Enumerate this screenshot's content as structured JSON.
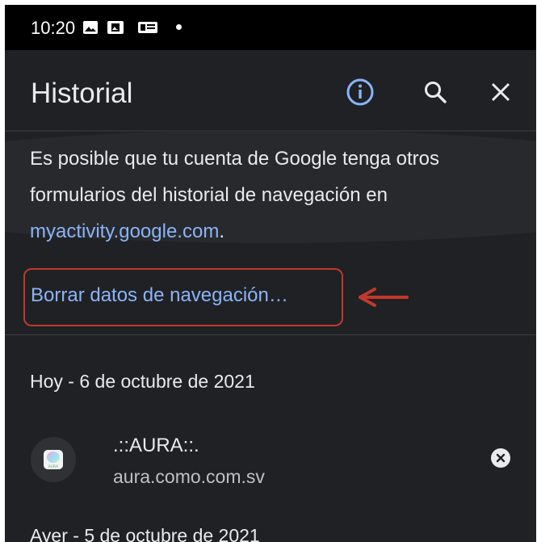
{
  "status_bar": {
    "time": "10:20"
  },
  "app_bar": {
    "title": "Historial",
    "icons": [
      "info-icon",
      "search-icon",
      "close-icon"
    ]
  },
  "info": {
    "text_before": "Es posible que tu cuenta de Google tenga otros formularios del historial de navegación en ",
    "link": "myactivity.google.com",
    "text_after": "."
  },
  "clear_data": {
    "label": "Borrar datos de navegación…"
  },
  "history": {
    "groups": [
      {
        "date": "Hoy - 6 de octubre de 2021",
        "items": [
          {
            "title": ".::AURA::.",
            "url": "aura.como.com.sv",
            "favicon_text": "AURA"
          }
        ]
      },
      {
        "date": "Ayer - 5 de octubre de 2021"
      }
    ]
  },
  "colors": {
    "background": "#202124",
    "link": "#8ab4f8",
    "highlight": "#c0392b"
  }
}
